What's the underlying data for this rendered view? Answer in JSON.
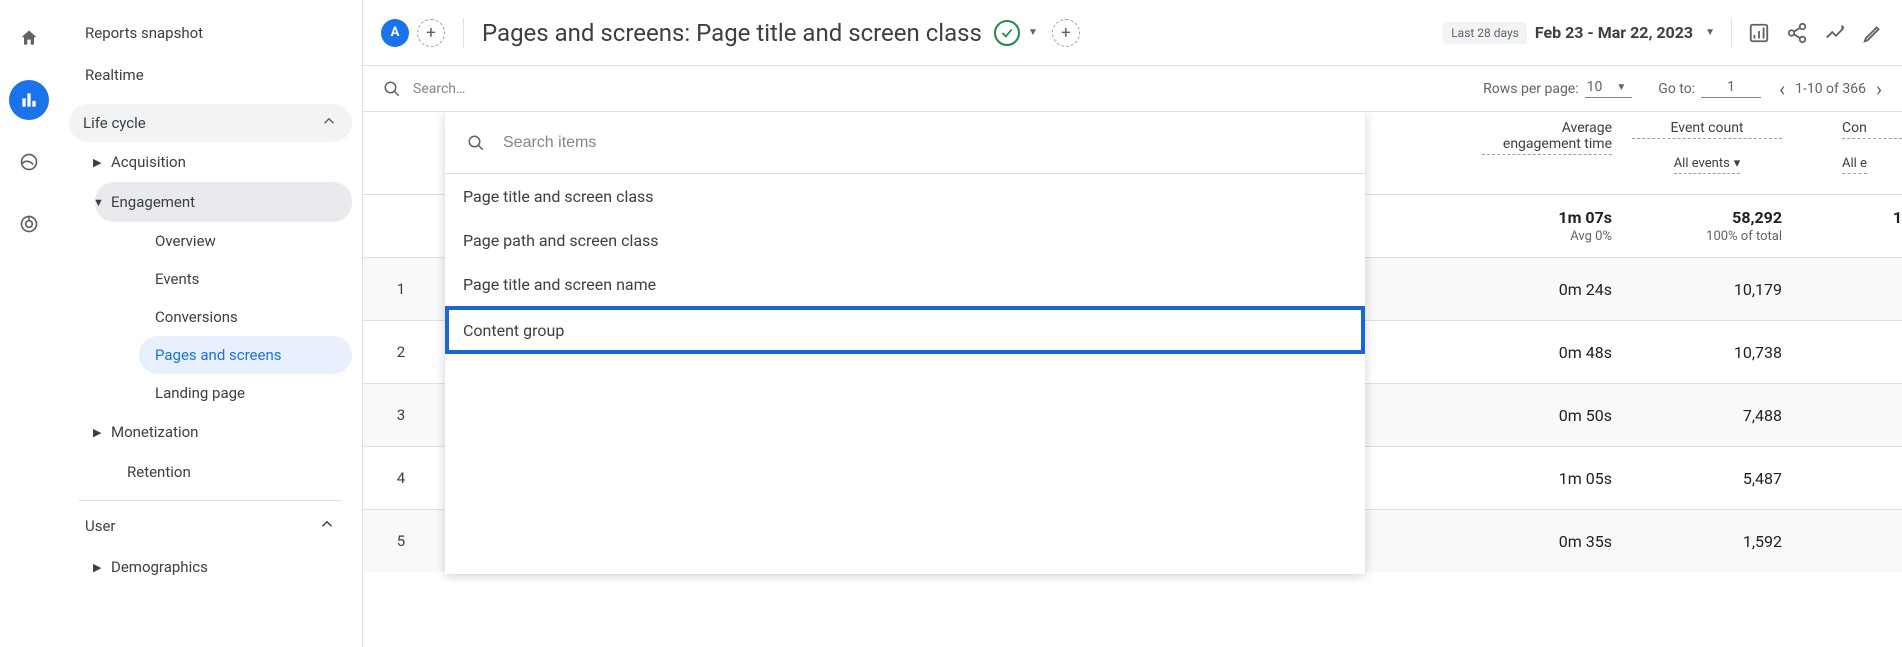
{
  "rail": {
    "icons": [
      "home",
      "reports",
      "advertising",
      "explore"
    ]
  },
  "sidebar": {
    "items": [
      {
        "label": "Reports snapshot"
      },
      {
        "label": "Realtime"
      }
    ],
    "sections": [
      {
        "label": "Life cycle",
        "children": [
          {
            "label": "Acquisition",
            "expanded": false
          },
          {
            "label": "Engagement",
            "expanded": true,
            "children": [
              {
                "label": "Overview"
              },
              {
                "label": "Events"
              },
              {
                "label": "Conversions"
              },
              {
                "label": "Pages and screens",
                "selected": true
              },
              {
                "label": "Landing page"
              }
            ]
          },
          {
            "label": "Monetization",
            "expanded": false
          },
          {
            "label": "Retention"
          }
        ]
      },
      {
        "label": "User",
        "children": [
          {
            "label": "Demographics"
          }
        ]
      }
    ]
  },
  "header": {
    "comparison_chip": "A",
    "title": "Pages and screens: Page title and screen class",
    "period_label": "Last 28 days",
    "date_range": "Feb 23 - Mar 22, 2023"
  },
  "toolbar": {
    "search_placeholder": "Search…",
    "rows_per_page_label": "Rows per page:",
    "rows_per_page_value": "10",
    "go_to_label": "Go to:",
    "go_to_value": "1",
    "range_label": "1-10 of 366"
  },
  "columns": {
    "c1": {
      "label": "Average engagement time"
    },
    "c2": {
      "label": "Event count",
      "sub": "All events"
    },
    "c3": {
      "label": "Con",
      "sub": "All e"
    }
  },
  "totals": {
    "c1": "1m 07s",
    "c1_sub": "Avg 0%",
    "c2": "58,292",
    "c2_sub": "100% of total",
    "c3": "1"
  },
  "rows": [
    {
      "i": "1",
      "c1": "0m 24s",
      "c2": "10,179"
    },
    {
      "i": "2",
      "c1": "0m 48s",
      "c2": "10,738"
    },
    {
      "i": "3",
      "c1": "0m 50s",
      "c2": "7,488"
    },
    {
      "i": "4",
      "c1": "1m 05s",
      "c2": "5,487"
    },
    {
      "i": "5",
      "c1": "0m 35s",
      "c2": "1,592"
    }
  ],
  "dropdown": {
    "search_placeholder": "Search items",
    "items": [
      "Page title and screen class",
      "Page path and screen class",
      "Page title and screen name",
      "Content group"
    ]
  }
}
